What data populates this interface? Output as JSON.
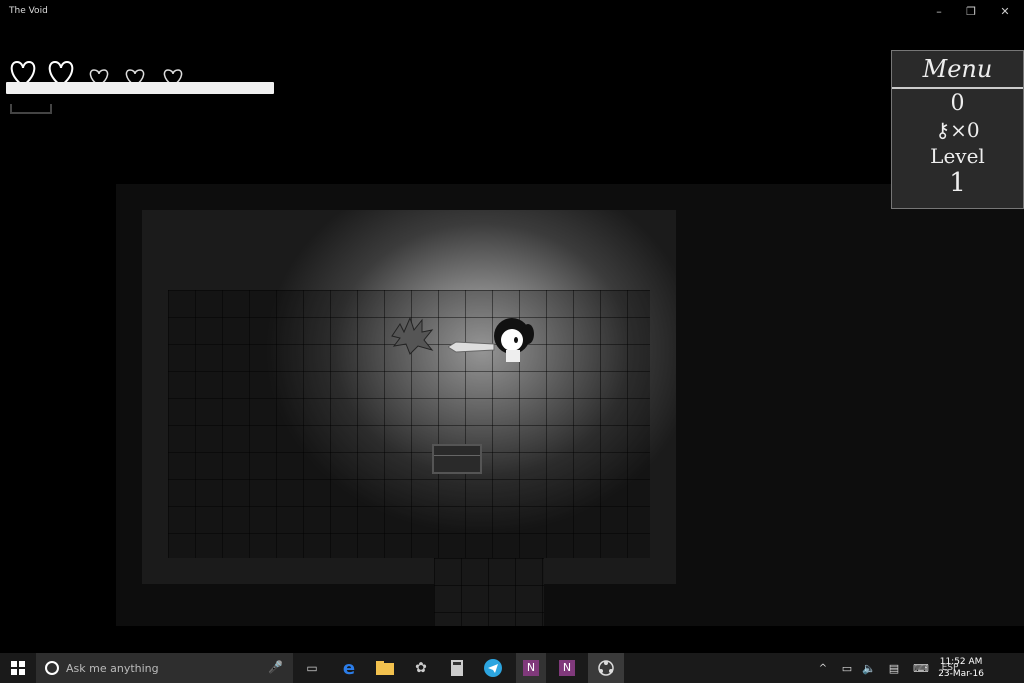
{
  "window": {
    "title": "The Void"
  },
  "hud": {
    "hearts_total": 5,
    "hearts_full": 2
  },
  "menu": {
    "title": "Menu",
    "score": "0",
    "keys_label": "×0",
    "level_label": "Level",
    "level_number": "1"
  },
  "taskbar": {
    "search_placeholder": "Ask me anything",
    "language": "ESP",
    "time": "11:52 AM",
    "date": "23-Mar-16"
  }
}
